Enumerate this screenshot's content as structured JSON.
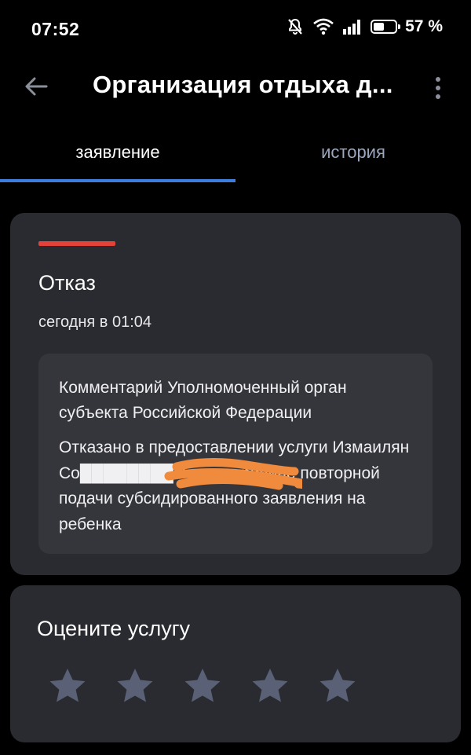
{
  "status_bar": {
    "time": "07:52",
    "battery": "57 %",
    "battery_level": 0.57,
    "icons": [
      "bell-muted-icon",
      "wifi-icon",
      "signal-icon",
      "battery-icon"
    ]
  },
  "app_bar": {
    "title": "Организация отдыха д...",
    "back_icon": "arrow-left-icon",
    "menu_icon": "more-vertical-icon"
  },
  "tabs": [
    {
      "label": "заявление",
      "active": true
    },
    {
      "label": "история",
      "active": false
    }
  ],
  "status_card": {
    "accent_color": "#e5413b",
    "title": "Отказ",
    "date": "сегодня в 01:04",
    "comment": {
      "title": "Комментарий Уполномоченный орган субъекта Российской Федерации",
      "body": "Отказано в предоставлении услуги Измаилян Со████████вна: по причине повторной подачи субсидированного заявления на ребенка"
    }
  },
  "rating_card": {
    "title": "Оцените услугу",
    "stars_total": 5,
    "rating": 0
  },
  "colors": {
    "background": "#000000",
    "card": "#2a2b30",
    "tab_indicator": "#3d7ddb",
    "star": "#5a6075"
  }
}
